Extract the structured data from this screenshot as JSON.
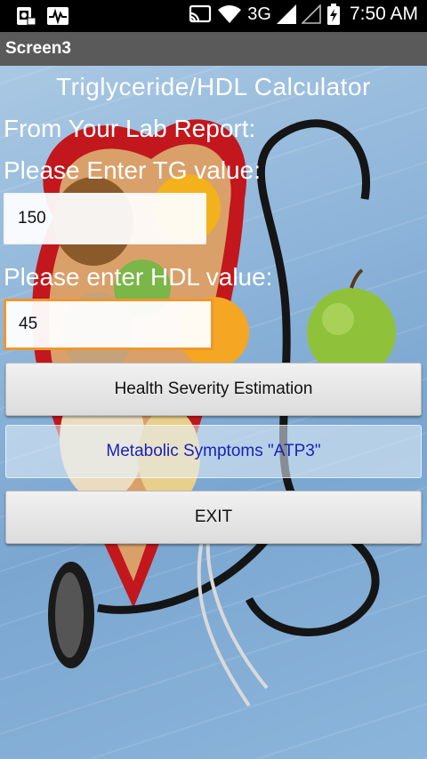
{
  "status_bar": {
    "time": "7:50 AM",
    "network": "3G",
    "icons": [
      "screenshot-icon",
      "activity-icon",
      "cast-icon",
      "wifi-icon",
      "signal-icon",
      "signal-empty-icon",
      "battery-charging-icon"
    ]
  },
  "title_bar": {
    "title": "Screen3"
  },
  "main": {
    "heading": "Triglyceride/HDL Calculator",
    "instruction": "From Your Lab Report:",
    "tg_label": "Please Enter TG value:",
    "tg_value": "150",
    "hdl_label": "Please enter HDL value:",
    "hdl_value": "45",
    "buttons": {
      "health": "Health Severity Estimation",
      "atp3": "Metabolic Symptoms \"ATP3\"",
      "exit": "EXIT"
    }
  },
  "colors": {
    "status_bar": "#000000",
    "title_bar": "#5a5a5a",
    "background_blue": "#8db4d9",
    "hdl_focus_border": "#f0962e",
    "atp3_text": "#1a23b8"
  }
}
